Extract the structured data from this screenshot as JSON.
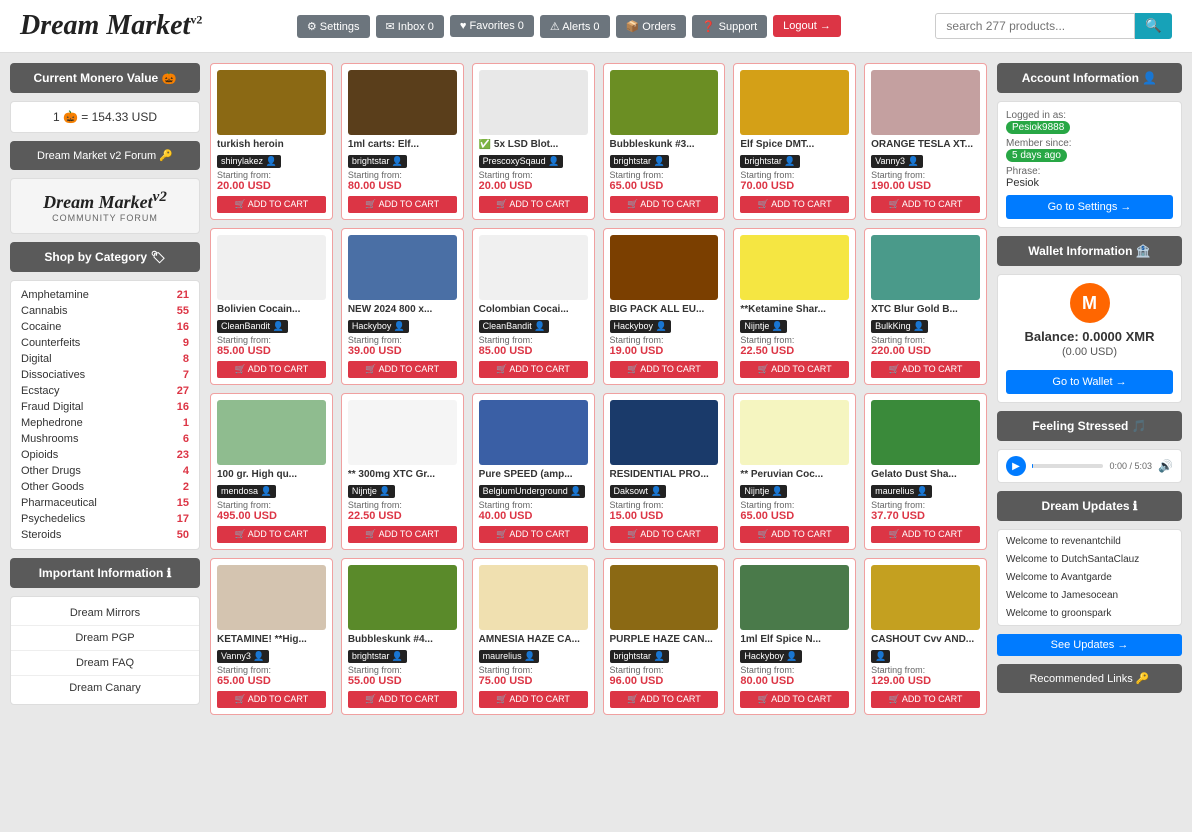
{
  "header": {
    "logo": "Dream Market",
    "logo_sup": "v2",
    "search_placeholder": "search 277 products...",
    "nav_buttons": [
      {
        "label": "⚙ Settings",
        "id": "settings"
      },
      {
        "label": "✉ Inbox 0",
        "id": "inbox"
      },
      {
        "label": "♥ Favorites 0",
        "id": "favorites"
      },
      {
        "label": "⚠ Alerts 0",
        "id": "alerts"
      },
      {
        "label": "📦 Orders",
        "id": "orders"
      },
      {
        "label": "❓ Support",
        "id": "support"
      },
      {
        "label": "Logout →",
        "id": "logout",
        "class": "logout"
      }
    ]
  },
  "sidebar": {
    "monero_title": "Current Monero Value 🎃",
    "monero_rate": "1 🎃 = 154.33 USD",
    "forum_label": "Dream Market v2 Forum 🔑",
    "forum_logo_text": "Dream Market",
    "forum_logo_sup": "v2",
    "forum_logo_sub": "COMMUNITY FORUM",
    "category_title": "Shop by Category 🏷",
    "categories": [
      {
        "name": "Amphetamine",
        "count": "21"
      },
      {
        "name": "Cannabis",
        "count": "55"
      },
      {
        "name": "Cocaine",
        "count": "16"
      },
      {
        "name": "Counterfeits",
        "count": "9"
      },
      {
        "name": "Digital",
        "count": "8"
      },
      {
        "name": "Dissociatives",
        "count": "7"
      },
      {
        "name": "Ecstacy",
        "count": "27"
      },
      {
        "name": "Fraud Digital",
        "count": "16"
      },
      {
        "name": "Mephedrone",
        "count": "1"
      },
      {
        "name": "Mushrooms",
        "count": "6"
      },
      {
        "name": "Opioids",
        "count": "23"
      },
      {
        "name": "Other Drugs",
        "count": "4"
      },
      {
        "name": "Other Goods",
        "count": "2"
      },
      {
        "name": "Pharmaceutical",
        "count": "15"
      },
      {
        "name": "Psychedelics",
        "count": "17"
      },
      {
        "name": "Steroids",
        "count": "50"
      }
    ],
    "info_title": "Important Information ℹ",
    "info_links": [
      {
        "label": "Dream Mirrors"
      },
      {
        "label": "Dream PGP"
      },
      {
        "label": "Dream FAQ"
      },
      {
        "label": "Dream Canary"
      }
    ]
  },
  "products": [
    {
      "title": "turkish heroin",
      "seller": "shinylakez",
      "price": "20.00 USD",
      "img_color": "#8B6914"
    },
    {
      "title": "1ml carts: Elf...",
      "seller": "brightstar",
      "price": "80.00 USD",
      "img_color": "#5a3e1b"
    },
    {
      "title": "✅ 5x LSD Blot...",
      "seller": "PrescoxySqaud",
      "price": "20.00 USD",
      "img_color": "#e8e8e8"
    },
    {
      "title": "Bubbleskunk #3...",
      "seller": "brightstar",
      "price": "65.00 USD",
      "img_color": "#6b8e23"
    },
    {
      "title": "Elf Spice DMT...",
      "seller": "brightstar",
      "price": "70.00 USD",
      "img_color": "#d4a017"
    },
    {
      "title": "ORANGE TESLA XT...",
      "seller": "Vanny3",
      "price": "190.00 USD",
      "img_color": "#c4a0a0"
    },
    {
      "title": "Bolivien Cocain...",
      "seller": "CleanBandit",
      "price": "85.00 USD",
      "img_color": "#f0f0f0"
    },
    {
      "title": "NEW 2024 800 x...",
      "seller": "Hackyboy",
      "price": "39.00 USD",
      "img_color": "#4a6fa5"
    },
    {
      "title": "Colombian Cocai...",
      "seller": "CleanBandit",
      "price": "85.00 USD",
      "img_color": "#f0f0f0"
    },
    {
      "title": "BIG PACK ALL EU...",
      "seller": "Hackyboy",
      "price": "19.00 USD",
      "img_color": "#7b3f00"
    },
    {
      "title": "**Ketamine Shar...",
      "seller": "Nijntje",
      "price": "22.50 USD",
      "img_color": "#f5e642"
    },
    {
      "title": "XTC Blur Gold B...",
      "seller": "BulkKing",
      "price": "220.00 USD",
      "img_color": "#4a9a8a"
    },
    {
      "title": "100 gr. High qu...",
      "seller": "mendosa",
      "price": "495.00 USD",
      "img_color": "#8fbc8f"
    },
    {
      "title": "** 300mg XTC Gr...",
      "seller": "Nijntje",
      "price": "22.50 USD",
      "img_color": "#f5f5f5"
    },
    {
      "title": "Pure SPEED (amp...",
      "seller": "BelgiumUnderground",
      "price": "40.00 USD",
      "img_color": "#3a5fa5"
    },
    {
      "title": "RESIDENTIAL PRO...",
      "seller": "Daksowt",
      "price": "15.00 USD",
      "img_color": "#1a3a6a"
    },
    {
      "title": "** Peruvian Coc...",
      "seller": "Nijntje",
      "price": "65.00 USD",
      "img_color": "#f5f5c0"
    },
    {
      "title": "Gelato Dust Sha...",
      "seller": "maurelius",
      "price": "37.70 USD",
      "img_color": "#3a8a3a"
    },
    {
      "title": "KETAMINE! **Hig...",
      "seller": "Vanny3",
      "price": "65.00 USD",
      "img_color": "#d4c4b0"
    },
    {
      "title": "Bubbleskunk #4...",
      "seller": "brightstar",
      "price": "55.00 USD",
      "img_color": "#5a8a2a"
    },
    {
      "title": "AMNESIA HAZE CA...",
      "seller": "maurelius",
      "price": "75.00 USD",
      "img_color": "#f0e0b0"
    },
    {
      "title": "PURPLE HAZE CAN...",
      "seller": "brightstar",
      "price": "96.00 USD",
      "img_color": "#8B6914"
    },
    {
      "title": "1ml Elf Spice N...",
      "seller": "Hackyboy",
      "price": "80.00 USD",
      "img_color": "#4a7a4a"
    },
    {
      "title": "CASHOUT Cvv AND...",
      "seller": "",
      "price": "129.00 USD",
      "img_color": "#c4a020"
    }
  ],
  "right_panel": {
    "account_title": "Account Information 👤",
    "logged_in_label": "Logged in as:",
    "username": "Pesiok9888",
    "member_since_label": "Member since:",
    "member_since": "5 days ago",
    "phrase_label": "Phrase:",
    "phrase": "Pesiok",
    "go_settings_btn": "Go to Settings →",
    "wallet_title": "Wallet Information 🏦",
    "xmr_balance": "Balance: 0.0000 XMR",
    "usd_balance": "(0.00 USD)",
    "go_wallet_btn": "Go to Wallet →",
    "stressed_title": "Feeling Stressed 🎵",
    "audio_time": "0:00",
    "audio_total": "5:03",
    "updates_title": "Dream Updates ℹ",
    "updates": [
      {
        "text": "Welcome to revenantchild"
      },
      {
        "text": "Welcome to DutchSantaClauz"
      },
      {
        "text": "Welcome to Avantgarde"
      },
      {
        "text": "Welcome to Jamesocean"
      },
      {
        "text": "Welcome to groonspark"
      }
    ],
    "see_updates_btn": "See Updates →",
    "rec_links_title": "Recommended Links 🔑"
  },
  "labels": {
    "starting_from": "Starting from:",
    "add_to_cart": "ADD TO CART",
    "cart_icon": "🛒"
  }
}
